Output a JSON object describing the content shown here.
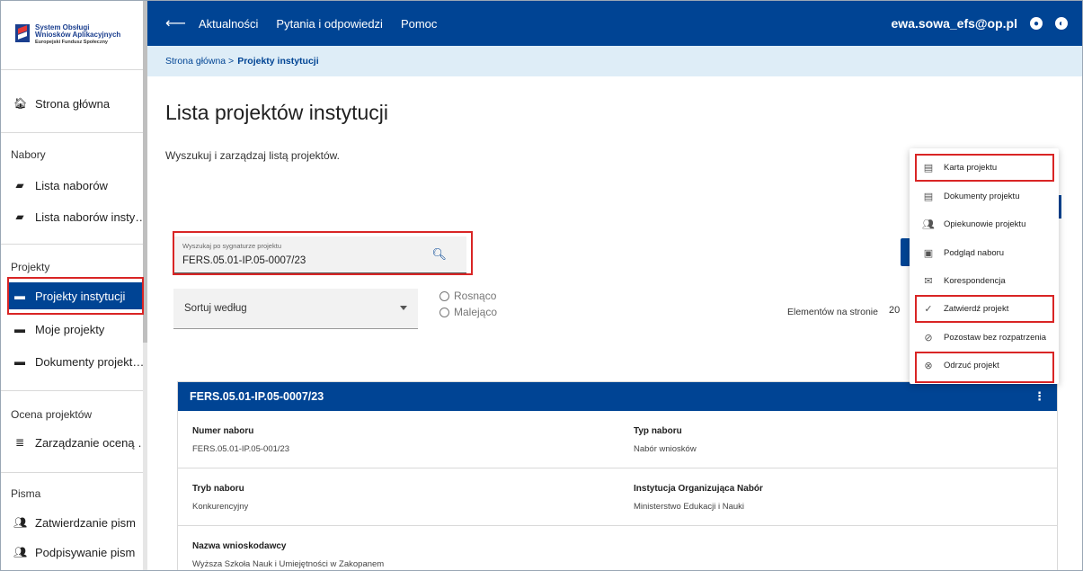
{
  "logo": {
    "line1": "System Obsługi",
    "line2": "Wniosków Aplikacyjnych",
    "line3": "Europejski Fundusz Społeczny"
  },
  "sidebar": {
    "home": "Strona główna",
    "sections": [
      {
        "title": "Nabory",
        "items": [
          {
            "label": "Lista naborów",
            "icon": "ballot-box-icon"
          },
          {
            "label": "Lista naborów insty…",
            "icon": "ballot-box-icon"
          }
        ]
      },
      {
        "title": "Projekty",
        "items": [
          {
            "label": "Projekty instytucji",
            "icon": "card-icon"
          },
          {
            "label": "Moje projekty",
            "icon": "card-icon"
          },
          {
            "label": "Dokumenty projekt…",
            "icon": "card-icon"
          }
        ]
      },
      {
        "title": "Ocena projektów",
        "items": [
          {
            "label": "Zarządzanie oceną …",
            "icon": "list-icon"
          }
        ]
      },
      {
        "title": "Pisma",
        "items": [
          {
            "label": "Zatwierdzanie pism",
            "icon": "people-icon"
          },
          {
            "label": "Podpisywanie pism",
            "icon": "people-icon"
          }
        ]
      }
    ]
  },
  "topbar": {
    "nav": [
      "Aktualności",
      "Pytania i odpowiedzi",
      "Pomoc"
    ],
    "user_email": "ewa.sowa_efs@op.pl"
  },
  "breadcrumb": {
    "home": "Strona główna >",
    "current": "Projekty instytucji"
  },
  "page": {
    "title": "Lista projektów instytucji",
    "description": "Wyszukuj i zarządzaj listą projektów."
  },
  "search": {
    "label": "Wyszukaj po sygnaturze projektu",
    "value": "FERS.05.01-IP.05-0007/23"
  },
  "sort": {
    "label": "Sortuj według",
    "options": [
      "Rosnąco",
      "Malejąco"
    ]
  },
  "pagination": {
    "label": "Elementów na stronie",
    "value": "20"
  },
  "card": {
    "title": "FERS.05.01-IP.05-0007/23",
    "fields": [
      {
        "key": "Numer naboru",
        "value": "FERS.05.01-IP.05-001/23"
      },
      {
        "key": "Typ naboru",
        "value": "Nabór wniosków"
      },
      {
        "key": "Tryb naboru",
        "value": "Konkurencyjny"
      },
      {
        "key": "Instytucja Organizująca Nabór",
        "value": "Ministerstwo Edukacji i Nauki"
      },
      {
        "key": "Nazwa wnioskodawcy",
        "value": "Wyższa Szkoła Nauk i Umiejętności w Zakopanem"
      }
    ]
  },
  "menu": {
    "items": [
      {
        "label": "Karta projektu",
        "icon": "clipboard-icon"
      },
      {
        "label": "Dokumenty projektu",
        "icon": "document-icon"
      },
      {
        "label": "Opiekunowie projektu",
        "icon": "people-icon"
      },
      {
        "label": "Podgląd naboru",
        "icon": "preview-icon"
      },
      {
        "label": "Korespondencja",
        "icon": "mail-icon"
      },
      {
        "label": "Zatwierdź projekt",
        "icon": "check-icon"
      },
      {
        "label": "Pozostaw bez rozpatrzenia",
        "icon": "eye-off-icon"
      },
      {
        "label": "Odrzuć projekt",
        "icon": "cancel-circle-icon"
      }
    ]
  },
  "colors": {
    "primary": "#004494",
    "highlight": "#d92525",
    "breadcrumb_bg": "#deedf7"
  }
}
